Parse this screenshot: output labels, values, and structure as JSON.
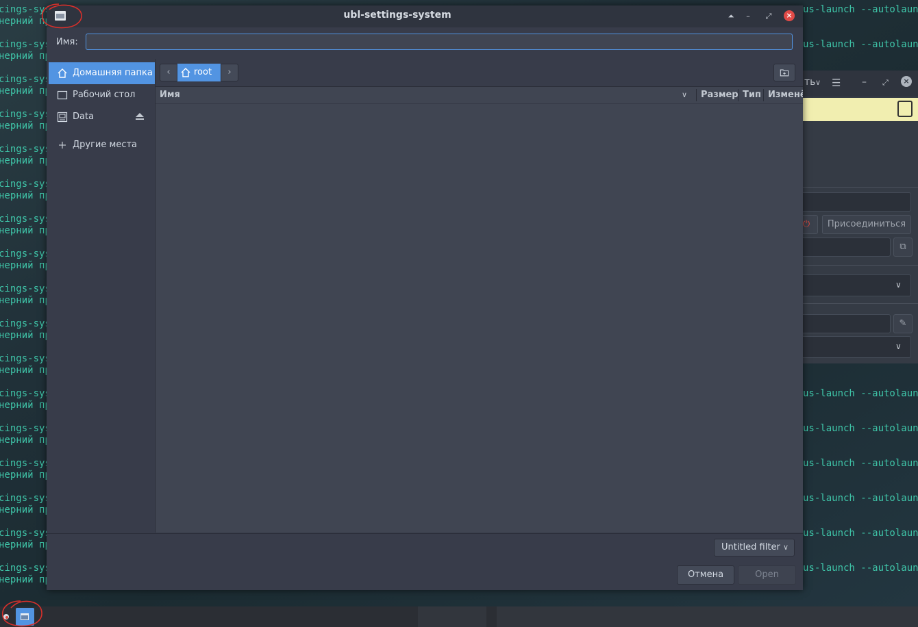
{
  "terminal": {
    "line_a_left": "cings-sys",
    "line_b_left": "нерний пр",
    "line_a_right": "us-launch --autolaunc",
    "top_left_a": "cings-sys",
    "top_left_b": "нерний пр"
  },
  "background_app": {
    "menu_label": "ть",
    "connect_button": "Присоединиться"
  },
  "dialog": {
    "title": "ubl-settings-system",
    "name_label": "Имя:",
    "name_value": "",
    "sidebar": [
      {
        "label": "Домашняя папка",
        "icon": "home-icon",
        "active": true
      },
      {
        "label": "Рабочий стол",
        "icon": "desktop-icon",
        "active": false
      },
      {
        "label": "Data",
        "icon": "drive-icon",
        "active": false,
        "eject": true
      },
      {
        "label": "Другие места",
        "icon": "plus-icon",
        "active": false
      }
    ],
    "path": {
      "crumbs": [
        "root"
      ],
      "back_icon": "chevron-left-icon",
      "forward_icon": "chevron-right-icon",
      "new_folder_icon": "new-folder-icon"
    },
    "columns": [
      "Имя",
      "Размер",
      "Тип",
      "Изменён"
    ],
    "filter": "Untitled filter",
    "cancel_label": "Отмена",
    "open_label": "Open"
  },
  "colors": {
    "accent": "#5294e2",
    "close": "#e04a47",
    "terminal_text": "#3fc6a9"
  }
}
